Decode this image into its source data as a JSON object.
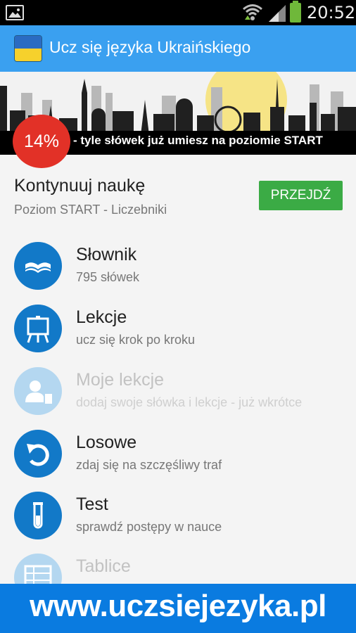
{
  "status_bar": {
    "time": "20:52",
    "icons": [
      "gallery-icon",
      "wifi-icon",
      "signal-icon",
      "battery-icon"
    ]
  },
  "app_bar": {
    "title": "Ucz się języka Ukraińskiego",
    "logo_icon": "ukraine-flag-icon"
  },
  "banner": {
    "percent": "14%",
    "text": "- tyle słówek już umiesz na poziomie START"
  },
  "continue": {
    "heading": "Kontynuuj naukę",
    "subtitle": "Poziom START - Liczebniki",
    "button_label": "PRZEJDŹ"
  },
  "menu": [
    {
      "label": "Słownik",
      "desc": "795 słówek",
      "icon": "book-icon",
      "enabled": true
    },
    {
      "label": "Lekcje",
      "desc": "ucz się krok po kroku",
      "icon": "easel-icon",
      "enabled": true
    },
    {
      "label": "Moje lekcje",
      "desc": "dodaj swoje słówka i lekcje - już wkrótce",
      "icon": "user-edit-icon",
      "enabled": false
    },
    {
      "label": "Losowe",
      "desc": "zdaj się na szczęśliwy traf",
      "icon": "undo-icon",
      "enabled": true
    },
    {
      "label": "Test",
      "desc": "sprawdź postępy w nauce",
      "icon": "test-tube-icon",
      "enabled": true
    },
    {
      "label": "Tablice",
      "desc": "",
      "icon": "table-icon",
      "enabled": false
    }
  ],
  "footer": {
    "url": "www.uczsiejezyka.pl"
  },
  "colors": {
    "app_bar": "#3aa0f0",
    "icon_circle": "#1279c8",
    "icon_circle_disabled": "#b4d7f0",
    "go_button": "#3bab45",
    "percent_badge": "#e23127",
    "footer": "#0a7be0"
  }
}
